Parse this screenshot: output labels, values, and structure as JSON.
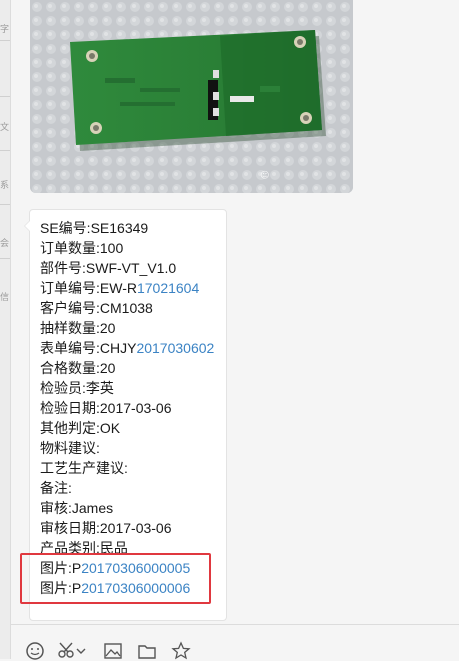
{
  "sidebar": {
    "glyphs": [
      "字",
      "文",
      "系",
      "会",
      "信"
    ]
  },
  "message": {
    "lines": [
      {
        "label": "SE编号:",
        "prefix": "SE16349",
        "link": ""
      },
      {
        "label": "订单数量:",
        "prefix": "100",
        "link": ""
      },
      {
        "label": "部件号:",
        "prefix": "SWF-VT_V1.0",
        "link": ""
      },
      {
        "label": "订单编号:",
        "prefix": "EW-R",
        "link": "17021604"
      },
      {
        "label": "客户编号:",
        "prefix": "CM1038",
        "link": ""
      },
      {
        "label": "抽样数量:",
        "prefix": "20",
        "link": ""
      },
      {
        "label": "表单编号:",
        "prefix": "CHJY",
        "link": "2017030602"
      },
      {
        "label": "合格数量:",
        "prefix": "20",
        "link": ""
      },
      {
        "label": "检验员:",
        "prefix": "李英",
        "link": ""
      },
      {
        "label": "检验日期:",
        "prefix": "2017-03-06",
        "link": ""
      },
      {
        "label": "其他判定:",
        "prefix": "OK",
        "link": ""
      },
      {
        "label": "物料建议:",
        "prefix": "",
        "link": ""
      },
      {
        "label": "工艺生产建议:",
        "prefix": "",
        "link": ""
      },
      {
        "label": "备注:",
        "prefix": "",
        "link": ""
      },
      {
        "label": "审核:",
        "prefix": "James",
        "link": ""
      },
      {
        "label": "审核日期:",
        "prefix": "2017-03-06",
        "link": ""
      },
      {
        "label": "产品类别:",
        "prefix": "民品",
        "link": ""
      },
      {
        "label": "图片:",
        "prefix": "P",
        "link": "20170306000005"
      },
      {
        "label": "图片:",
        "prefix": "P",
        "link": "20170306000006"
      }
    ]
  },
  "toolbar": {
    "icons": [
      "emoji-icon",
      "scissors-icon",
      "image-icon",
      "folder-icon",
      "star-icon"
    ]
  },
  "colors": {
    "link": "#3b83c4",
    "highlight": "#e0383f",
    "pcb": "#2f8a3c"
  }
}
